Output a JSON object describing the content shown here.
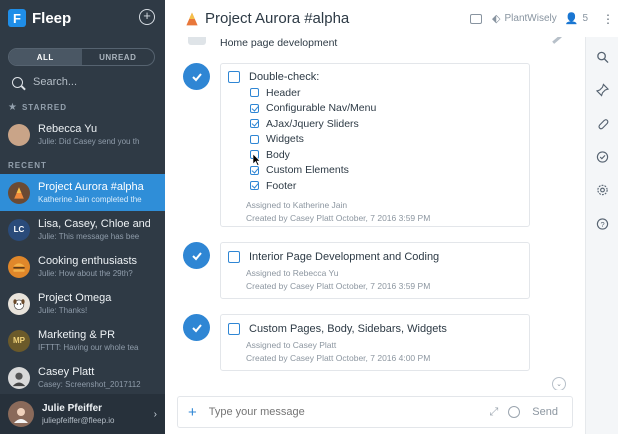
{
  "app": {
    "brand": "Fleep",
    "logo_letter": "F"
  },
  "sidebar": {
    "filters": [
      {
        "label": "ALL",
        "active": true
      },
      {
        "label": "UNREAD",
        "active": false
      }
    ],
    "search_placeholder": "Search...",
    "starred_label": "STARRED",
    "recent_label": "RECENT",
    "starred": [
      {
        "name": "Rebecca Yu",
        "preview": "Julie: Did Casey send you th",
        "avatar_color": "#c9a488"
      }
    ],
    "recent": [
      {
        "name": "Project Aurora #alpha",
        "preview": "Katherine Jain completed the",
        "avatar_color": "#7a4a2a",
        "selected": true
      },
      {
        "name": "Lisa, Casey, Chloe and o",
        "preview": "Julie: This message has bee",
        "avatar_text": "LC",
        "avatar_color": "#2a4b7a"
      },
      {
        "name": "Cooking enthusiasts",
        "preview": "Julie: How about the 29th?",
        "avatar_color": "#e0872a"
      },
      {
        "name": "Project Omega",
        "preview": "Julie: Thanks!",
        "avatar_color": "#e9e4dc"
      },
      {
        "name": "Marketing & PR",
        "preview": "IFTTT: Having our whole tea",
        "avatar_text": "MP",
        "avatar_color": "#6b5a2a"
      },
      {
        "name": "Casey Platt",
        "preview": "Casey: Screenshot_2017112",
        "avatar_color": "#d9d9d9"
      }
    ],
    "me": {
      "name": "Julie Pfeiffer",
      "email": "juliepfeiffer@fleep.io",
      "avatar_color": "#8a6a5a"
    }
  },
  "header": {
    "title": "Project Aurora #alpha",
    "tag": "PlantWisely",
    "members_count": "5"
  },
  "messages": {
    "partial_text": "Home page development",
    "tasks": [
      {
        "title": "Double-check:",
        "items": [
          {
            "label": "Header",
            "checked": false
          },
          {
            "label": "Configurable Nav/Menu",
            "checked": true
          },
          {
            "label": "AJax/Jquery Sliders",
            "checked": true
          },
          {
            "label": "Widgets",
            "checked": false
          },
          {
            "label": "Body",
            "checked": false
          },
          {
            "label": "Custom Elements",
            "checked": true
          },
          {
            "label": "Footer",
            "checked": true
          }
        ],
        "assigned": "Assigned to Katherine Jain",
        "created": "Created by Casey Platt  October, 7 2016 3:59 PM"
      },
      {
        "title": "Interior Page Development and Coding",
        "assigned": "Assigned to Rebecca Yu",
        "created": "Created by Casey Platt  October, 7 2016 3:59 PM"
      },
      {
        "title": "Custom Pages, Body, Sidebars, Widgets",
        "assigned": "Assigned to Casey Platt",
        "created": "Created by Casey Platt  October, 7 2016 4:00 PM"
      }
    ]
  },
  "composer": {
    "placeholder": "Type your message",
    "send_label": "Send"
  },
  "rail": {
    "icons": [
      "search-icon",
      "pin-icon",
      "paperclip-icon",
      "check-circle-icon",
      "gear-icon",
      "help-icon"
    ]
  },
  "colors": {
    "accent": "#2f86d4",
    "sidebar_bg": "#2f3a45",
    "selected": "#2f8ed8"
  }
}
